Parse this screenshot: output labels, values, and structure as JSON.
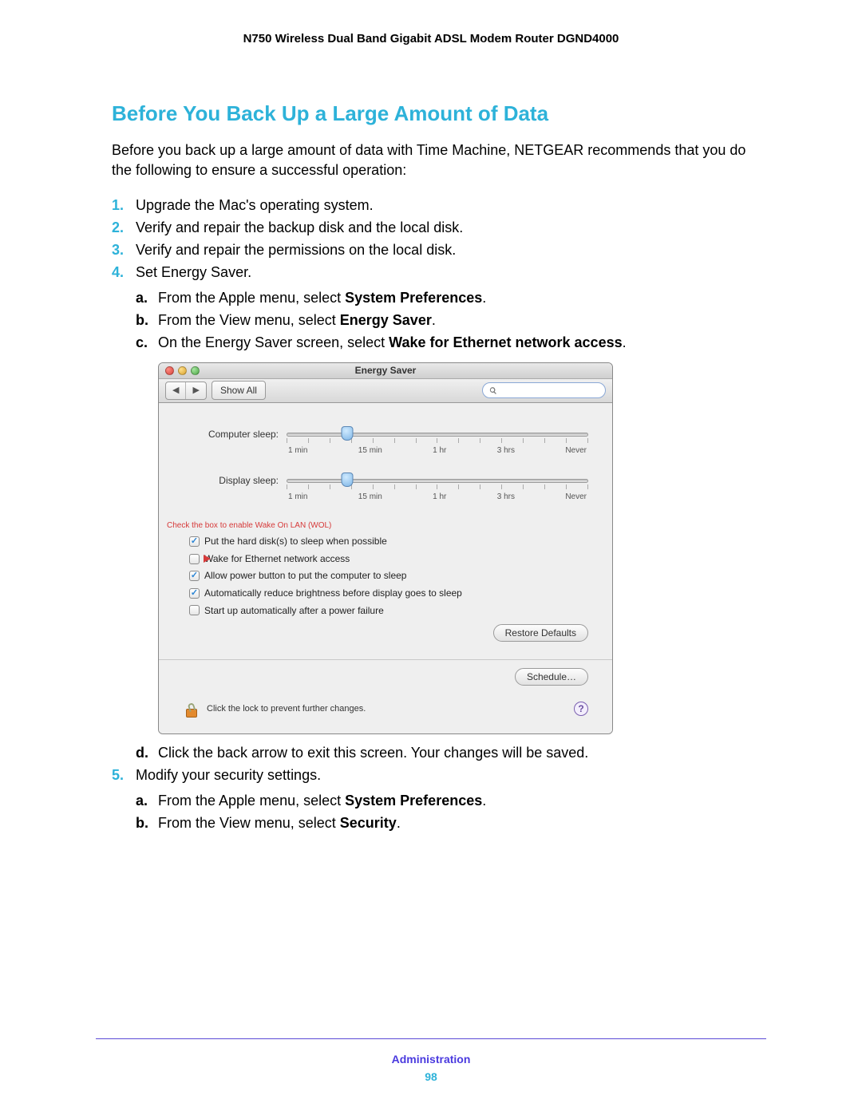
{
  "doc_header": "N750 Wireless Dual Band Gigabit ADSL Modem Router DGND4000",
  "section_title": "Before You Back Up a Large Amount of Data",
  "intro": "Before you back up a large amount of data with Time Machine, NETGEAR recommends that you do the following to ensure a successful operation:",
  "steps": {
    "s1": "Upgrade the Mac's operating system.",
    "s2": "Verify and repair the backup disk and the local disk.",
    "s3": "Verify and repair the permissions on the local disk.",
    "s4": "Set Energy Saver.",
    "s4a_pre": "From the Apple menu, select ",
    "s4a_bold": "System Preferences",
    "s4a_post": ".",
    "s4b_pre": "From the View menu, select ",
    "s4b_bold": "Energy Saver",
    "s4b_post": ".",
    "s4c_pre": "On the Energy Saver screen, select ",
    "s4c_bold": "Wake for Ethernet network access",
    "s4c_post": ".",
    "s4d": "Click the back arrow to exit this screen. Your changes will be saved.",
    "s5": "Modify your security settings.",
    "s5a_pre": "From the Apple menu, select ",
    "s5a_bold": "System Preferences",
    "s5a_post": ".",
    "s5b_pre": "From the View menu, select ",
    "s5b_bold": "Security",
    "s5b_post": "."
  },
  "mac": {
    "title": "Energy Saver",
    "showall": "Show All",
    "nav_back": "◀",
    "nav_fwd": "▶",
    "search_placeholder": "",
    "slider1_label": "Computer sleep:",
    "slider2_label": "Display sleep:",
    "ticks": {
      "t1": "1 min",
      "t2": "15 min",
      "t3": "1 hr",
      "t4": "3 hrs",
      "t5": "Never"
    },
    "wol_note": "Check the box to enable Wake On LAN (WOL)",
    "checks": {
      "c1": "Put the hard disk(s) to sleep when possible",
      "c2": "Wake for Ethernet network access",
      "c3": "Allow power button to put the computer to sleep",
      "c4": "Automatically reduce brightness before display goes to sleep",
      "c5": "Start up automatically after a power failure"
    },
    "restore": "Restore Defaults",
    "schedule": "Schedule…",
    "lock_text": "Click the lock to prevent further changes.",
    "help": "?"
  },
  "footer": {
    "section": "Administration",
    "page": "98"
  }
}
